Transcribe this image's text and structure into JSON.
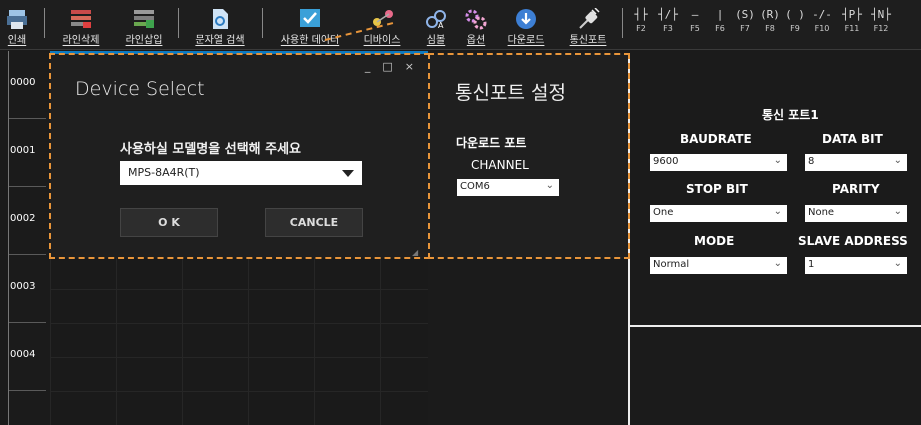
{
  "toolbar": {
    "items": [
      {
        "label": "인쇄",
        "icon": "printer-icon"
      },
      {
        "label": "라인삭제",
        "icon": "delete-line-icon"
      },
      {
        "label": "라인삽입",
        "icon": "insert-line-icon"
      },
      {
        "label": "문자열 검색",
        "icon": "search-document-icon"
      },
      {
        "label": "사용한 데이터",
        "icon": "checked-data-icon"
      },
      {
        "label": "디바이스",
        "icon": "device-icon"
      },
      {
        "label": "심볼",
        "icon": "symbol-icon"
      },
      {
        "label": "옵션",
        "icon": "options-gears-icon"
      },
      {
        "label": "다운로드",
        "icon": "download-icon"
      },
      {
        "label": "통신포트",
        "icon": "comm-port-plug-icon"
      }
    ],
    "function_keys": [
      {
        "symbol": "┤├",
        "key": "F2"
      },
      {
        "symbol": "┤/├",
        "key": "F3"
      },
      {
        "symbol": "—",
        "key": "F5"
      },
      {
        "symbol": "|",
        "key": "F6"
      },
      {
        "symbol": "(S)",
        "key": "F7"
      },
      {
        "symbol": "(R)",
        "key": "F8"
      },
      {
        "symbol": "( )",
        "key": "F9"
      },
      {
        "symbol": "-/-",
        "key": "F10"
      },
      {
        "symbol": "┤P├",
        "key": "F11"
      },
      {
        "symbol": "┤N├",
        "key": "F12"
      }
    ]
  },
  "rows": [
    "0000",
    "0001",
    "0002",
    "0003",
    "0004"
  ],
  "dialog": {
    "title": "Device Select",
    "window_buttons": [
      "_",
      "□",
      "×"
    ],
    "prompt": "사용하실 모델명을 선택해 주세요",
    "model_value": "MPS-8A4R(T)",
    "ok_label": "O K",
    "cancel_label": "CANCLE"
  },
  "comm_settings": {
    "title": "통신포트 설정",
    "download_port_label": "다운로드 포트",
    "channel_label": "CHANNEL",
    "channel_value": "COM6"
  },
  "port_panel": {
    "header": "통신 포트1",
    "baudrate_label": "BAUDRATE",
    "baudrate_value": "9600",
    "databit_label": "DATA BIT",
    "databit_value": "8",
    "stopbit_label": "STOP BIT",
    "stopbit_value": "One",
    "parity_label": "PARITY",
    "parity_value": "None",
    "mode_label": "MODE",
    "mode_value": "Normal",
    "slave_label": "SLAVE ADDRESS",
    "slave_value": "1"
  },
  "colors": {
    "accent_blue": "#0e7ac0",
    "selection_dash": "#e8953a",
    "background": "#1b1b1b"
  }
}
